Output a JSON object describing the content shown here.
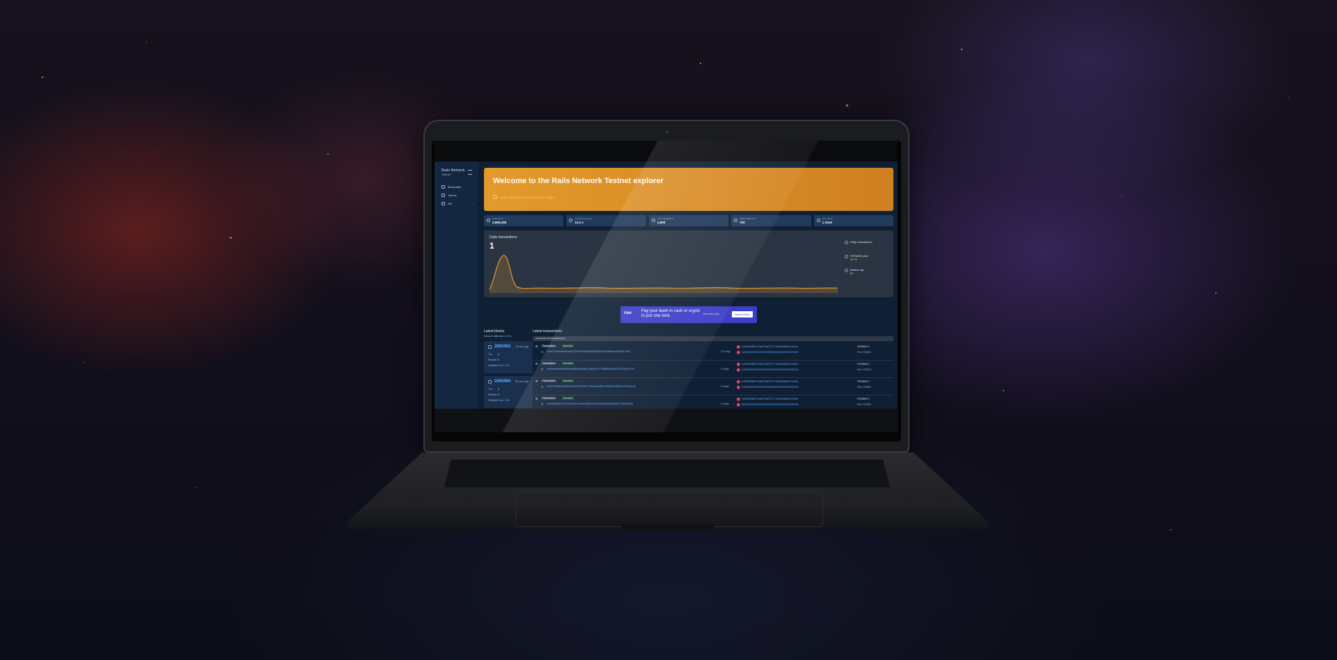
{
  "app": {
    "logo": "Rails Network",
    "logo_sub": "Testnet"
  },
  "sidebar": {
    "items": [
      {
        "label": "Blockchain",
        "icon": "blockchain-icon"
      },
      {
        "label": "Tokens",
        "icon": "tokens-icon"
      },
      {
        "label": "API",
        "icon": "api-icon"
      }
    ]
  },
  "hero": {
    "title": "Welcome to the Rails Network Testnet explorer",
    "search_placeholder": "Search by address / txn hash / block / token..."
  },
  "stats": [
    {
      "label": "Total blocks",
      "value": "2,865,338",
      "icon": "block-icon"
    },
    {
      "label": "Average block time",
      "value": "13.2 s",
      "icon": "clock-icon"
    },
    {
      "label": "Total transactions",
      "value": "2,808",
      "icon": "transactions-icon"
    },
    {
      "label": "Wallet addresses",
      "value": "750",
      "icon": "wallet-icon"
    },
    {
      "label": "Gas tracker",
      "value": "1 Gwei",
      "icon": "gas-icon"
    }
  ],
  "daily_chart": {
    "title": "Daily transactions",
    "value": "1",
    "legend": [
      {
        "label": "Daily transactions",
        "value": ""
      },
      {
        "label": "STEAMX price",
        "value": "$0.00"
      },
      {
        "label": "Market cap",
        "value": "$0"
      }
    ],
    "line_color": "#e39a2c"
  },
  "ad": {
    "logo": "rise",
    "text": "Pay your team in cash or crypto in just one click.",
    "sub": "Just one click.",
    "button": "Book a Demo"
  },
  "latest_blocks": {
    "title": "Latest blocks",
    "network_label": "Network utilization",
    "network_value": "0.00%",
    "blocks": [
      {
        "number": "2865962",
        "age": "10 secs ago",
        "txn": "0",
        "reward": "0",
        "validator": "0xa8...3f4c"
      },
      {
        "number": "2865960",
        "age": "55 secs ago",
        "txn": "0",
        "reward": "0",
        "validator": "0xa8...3f4c"
      }
    ],
    "labels": {
      "txn": "Txn",
      "reward": "Reward",
      "validator": "Validator"
    }
  },
  "latest_transactions": {
    "title": "Latest transactions",
    "notice": "Incoming new transactions...",
    "type_tag": "Transaction",
    "status_tag": "Success",
    "rows": [
      {
        "hash": "0xe8172b69cfb0bf4db872261f9e1b80fdd0f5d58f1ba1398bdf61ad6c82421f81",
        "age": "13 h ago",
        "from": "0x0D8308867445a0726f37917763d4648f43c7b0f0a",
        "to": "0x0000000000000000000000000000000000001000",
        "value": "STEAMX 0",
        "fee": "Fee 0.00904"
      },
      {
        "hash": "0x4ba9db9d5a93669ca6845e10866a7cf4ec93c7f72886e5c852a3196126b7a74d",
        "age": "1 d ago",
        "from": "0x0D8308867445a0726f37917763d4648f43c7b0f0a",
        "to": "0x0000000000000000000000000000000000001000",
        "value": "STEAMX 0",
        "fee": "Fee 0.00412"
      },
      {
        "hash": "0x16179bd8142d82a0a57e4b0701b471f9ebeb9d5fe179e8e6c2682bc2497ba4a16",
        "age": "4 d ago",
        "from": "0x0D8308867445a0726f37917763d4648f43c7b0f0a",
        "to": "0x0000000000000000000000000000000000001000",
        "value": "STEAMX 0",
        "fee": "Fee 0.00906"
      },
      {
        "hash": "0x9eb4a06b7e1c4c3b2d99c1ee6e4096f1a6c8c3b9bb2f9f266eab27c2322d4a63",
        "age": "4 d ago",
        "from": "0x0D8308867445a0726f37917763d4648f43c7b0f0a",
        "to": "0x0000000000000000000000000000000000001000",
        "value": "STEAMX 0",
        "fee": "Fee 0.00900"
      }
    ]
  }
}
